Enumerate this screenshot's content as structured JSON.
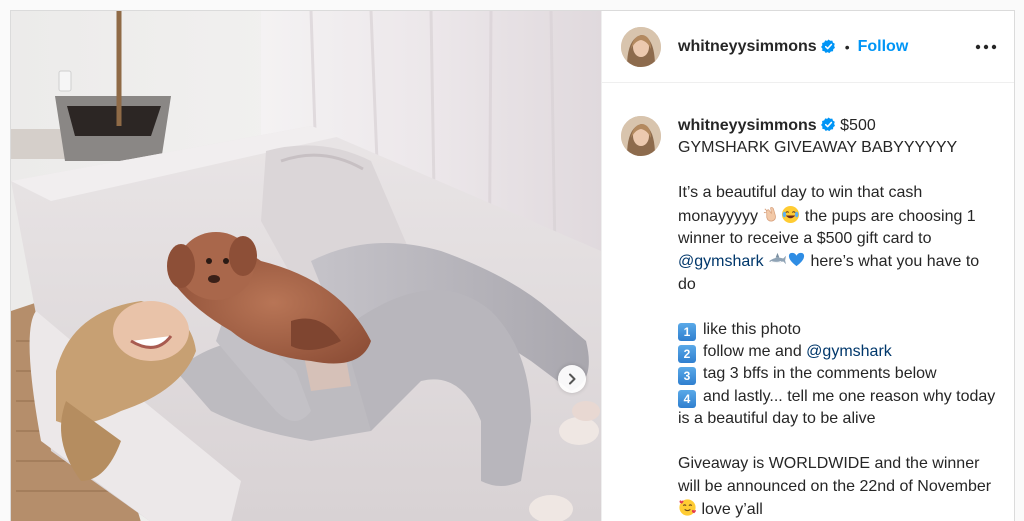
{
  "post": {
    "username": "whitneyysimmons",
    "follow_label": "Follow",
    "dot_separator": "•",
    "caption": {
      "line1_after_name": " $500",
      "line2": "GYMSHARK GIVEAWAY BABYYYYYY",
      "p1a": "It’s a beautiful day to win that cash monayyyyy ",
      "p1b": " the pups are choosing 1 winner to receive a $500 gift card to ",
      "mention1": "@gymshark",
      "p1c": " here’s what you have to do",
      "steps": [
        {
          "num": "1",
          "text": "like this photo"
        },
        {
          "num": "2",
          "text": "follow me and "
        },
        {
          "num": "3",
          "text": "tag 3 bffs in the comments below"
        },
        {
          "num": "4",
          "text": "and lastly... tell me one reason why today is a beautiful day to be alive"
        }
      ],
      "mention2": "@gymshark",
      "p2": "Giveaway is WORLDWIDE and the winner will be announced on the 22nd of November ",
      "p2b": " love y’all"
    },
    "icons": {
      "verified": "verified-badge-icon",
      "more": "more-options-icon",
      "next": "chevron-right-icon",
      "emojis": [
        "clapping-hands-icon",
        "laughing-face-icon",
        "shark-icon",
        "blue-heart-icon",
        "smiling-hearts-face-icon"
      ]
    },
    "colors": {
      "link": "#0095f6",
      "mention": "#00376b",
      "verified": "#0095f6"
    }
  }
}
